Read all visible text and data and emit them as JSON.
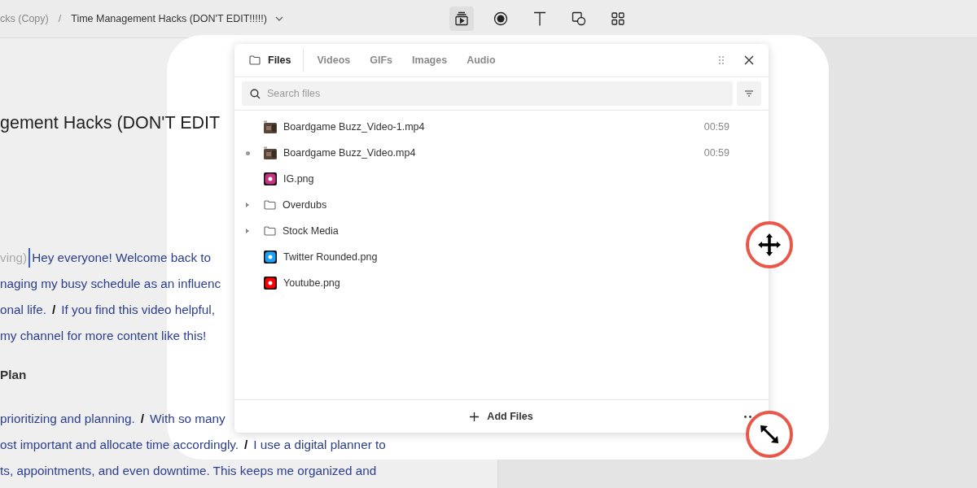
{
  "breadcrumb": {
    "parent": "cks (Copy)",
    "separator": "/",
    "title": "Time Management Hacks (DON'T EDIT!!!!!)"
  },
  "toolbar": [
    {
      "kind": "media",
      "selected": true
    },
    {
      "kind": "record",
      "selected": false
    },
    {
      "kind": "text",
      "selected": false
    },
    {
      "kind": "shapes",
      "selected": false
    },
    {
      "kind": "grid",
      "selected": false
    }
  ],
  "document": {
    "heading": "gement Hacks (DON'T EDIT",
    "lines": [
      {
        "kind": "para",
        "segments": [
          {
            "kind": "muted",
            "text": "ving)"
          },
          {
            "kind": "cursor"
          },
          {
            "kind": "text",
            "text": "Hey everyone! Welcome back to"
          }
        ]
      },
      {
        "kind": "para",
        "segments": [
          {
            "kind": "text",
            "text": "naging my busy schedule as an influenc"
          }
        ]
      },
      {
        "kind": "para",
        "segments": [
          {
            "kind": "text",
            "text": "onal life."
          },
          {
            "kind": "separator",
            "text": "/"
          },
          {
            "kind": "text",
            "text": "If you find this video helpful,"
          }
        ]
      },
      {
        "kind": "para",
        "segments": [
          {
            "kind": "text",
            "text": "my channel for more content like this!"
          }
        ]
      },
      {
        "kind": "heading",
        "segments": [
          {
            "kind": "text",
            "text": "Plan"
          }
        ]
      },
      {
        "kind": "para",
        "segments": [
          {
            "kind": "text",
            "text": "prioritizing and planning."
          },
          {
            "kind": "separator",
            "text": "/"
          },
          {
            "kind": "text",
            "text": "With so many"
          }
        ]
      },
      {
        "kind": "para",
        "segments": [
          {
            "kind": "text",
            "text": "ost important and allocate time accordingly."
          },
          {
            "kind": "separator",
            "text": "/"
          },
          {
            "kind": "text",
            "text": "I use a digital planner to"
          }
        ]
      },
      {
        "kind": "para",
        "segments": [
          {
            "kind": "text",
            "text": "ts, appointments, and even downtime. This keeps me organized and"
          }
        ]
      }
    ]
  },
  "panel": {
    "tabs": [
      {
        "label": "Files",
        "selected": true
      },
      {
        "label": "Videos",
        "selected": false
      },
      {
        "label": "GIFs",
        "selected": false
      },
      {
        "label": "Images",
        "selected": false
      },
      {
        "label": "Audio",
        "selected": false
      }
    ],
    "search": {
      "placeholder": "Search files"
    },
    "files": [
      {
        "kind": "video",
        "name": "Boardgame Buzz_Video-1.mp4",
        "duration": "00:59",
        "used": false
      },
      {
        "kind": "video",
        "name": "Boardgame Buzz_Video.mp4",
        "duration": "00:59",
        "used": true
      },
      {
        "kind": "image",
        "name": "IG.png",
        "color": "#c13584",
        "used": false
      },
      {
        "kind": "folder",
        "name": "Overdubs",
        "expanded": false
      },
      {
        "kind": "folder",
        "name": "Stock Media",
        "expanded": false
      },
      {
        "kind": "image",
        "name": "Twitter Rounded.png",
        "color": "#1da1f2",
        "used": false
      },
      {
        "kind": "image",
        "name": "Youtube.png",
        "color": "#ff0000",
        "used": false
      }
    ],
    "add_button": "Add Files"
  }
}
